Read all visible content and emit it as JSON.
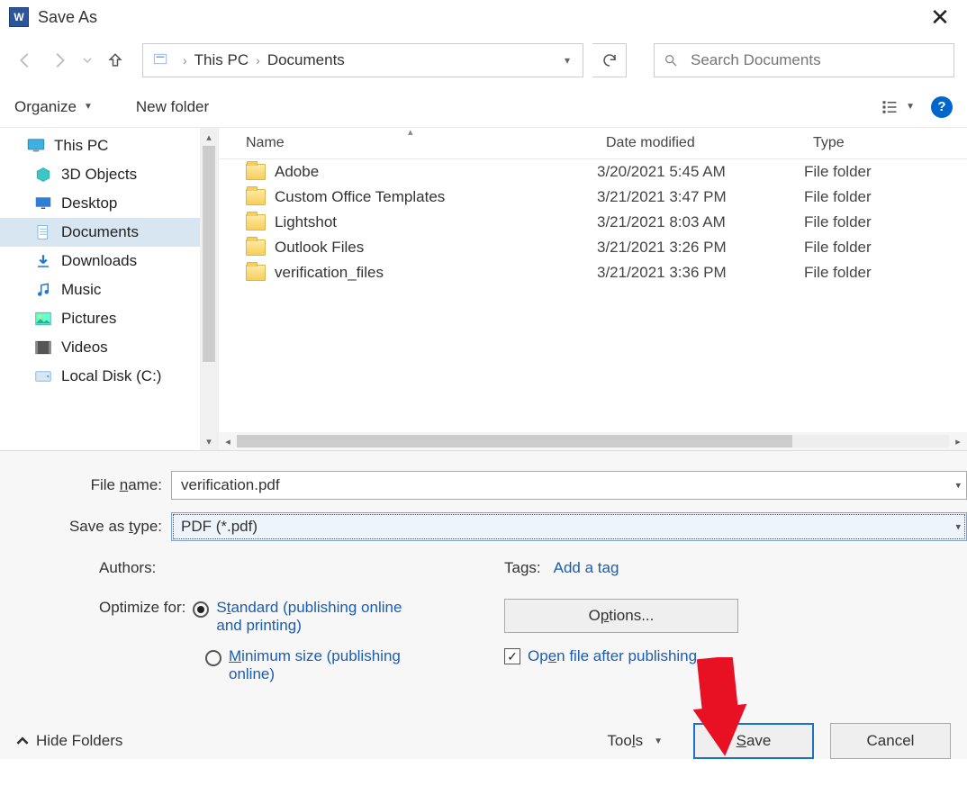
{
  "window": {
    "app_letter": "W",
    "title": "Save As"
  },
  "nav": {
    "breadcrumb": {
      "root": "This PC",
      "current": "Documents"
    },
    "search_placeholder": "Search Documents"
  },
  "toolbar": {
    "organize": "Organize",
    "new_folder": "New folder"
  },
  "sidebar": {
    "items": [
      {
        "label": "This PC",
        "icon": "monitor",
        "root": true,
        "selected": false
      },
      {
        "label": "3D Objects",
        "icon": "cube",
        "root": false,
        "selected": false
      },
      {
        "label": "Desktop",
        "icon": "desktop",
        "root": false,
        "selected": false
      },
      {
        "label": "Documents",
        "icon": "doc",
        "root": false,
        "selected": true
      },
      {
        "label": "Downloads",
        "icon": "download",
        "root": false,
        "selected": false
      },
      {
        "label": "Music",
        "icon": "music",
        "root": false,
        "selected": false
      },
      {
        "label": "Pictures",
        "icon": "pictures",
        "root": false,
        "selected": false
      },
      {
        "label": "Videos",
        "icon": "videos",
        "root": false,
        "selected": false
      },
      {
        "label": "Local Disk (C:)",
        "icon": "disk",
        "root": false,
        "selected": false
      }
    ]
  },
  "columns": {
    "name": "Name",
    "date": "Date modified",
    "type": "Type"
  },
  "files": [
    {
      "name": "Adobe",
      "date": "3/20/2021 5:45 AM",
      "type": "File folder"
    },
    {
      "name": "Custom Office Templates",
      "date": "3/21/2021 3:47 PM",
      "type": "File folder"
    },
    {
      "name": "Lightshot",
      "date": "3/21/2021 8:03 AM",
      "type": "File folder"
    },
    {
      "name": "Outlook Files",
      "date": "3/21/2021 3:26 PM",
      "type": "File folder"
    },
    {
      "name": "verification_files",
      "date": "3/21/2021 3:36 PM",
      "type": "File folder"
    }
  ],
  "form": {
    "filename_label": "File name:",
    "filename_value": "verification.pdf",
    "savetype_label": "Save as type:",
    "savetype_value": "PDF (*.pdf)",
    "authors_label": "Authors:",
    "tags_label": "Tags:",
    "add_tag": "Add a tag",
    "optimize_label": "Optimize for:",
    "optimize_standard": "Standard (publishing online and printing)",
    "optimize_minimum": "Minimum size (publishing online)",
    "options_btn": "Options...",
    "open_after": "Open file after publishing"
  },
  "actions": {
    "hide_folders": "Hide Folders",
    "tools": "Tools",
    "save": "Save",
    "cancel": "Cancel"
  }
}
